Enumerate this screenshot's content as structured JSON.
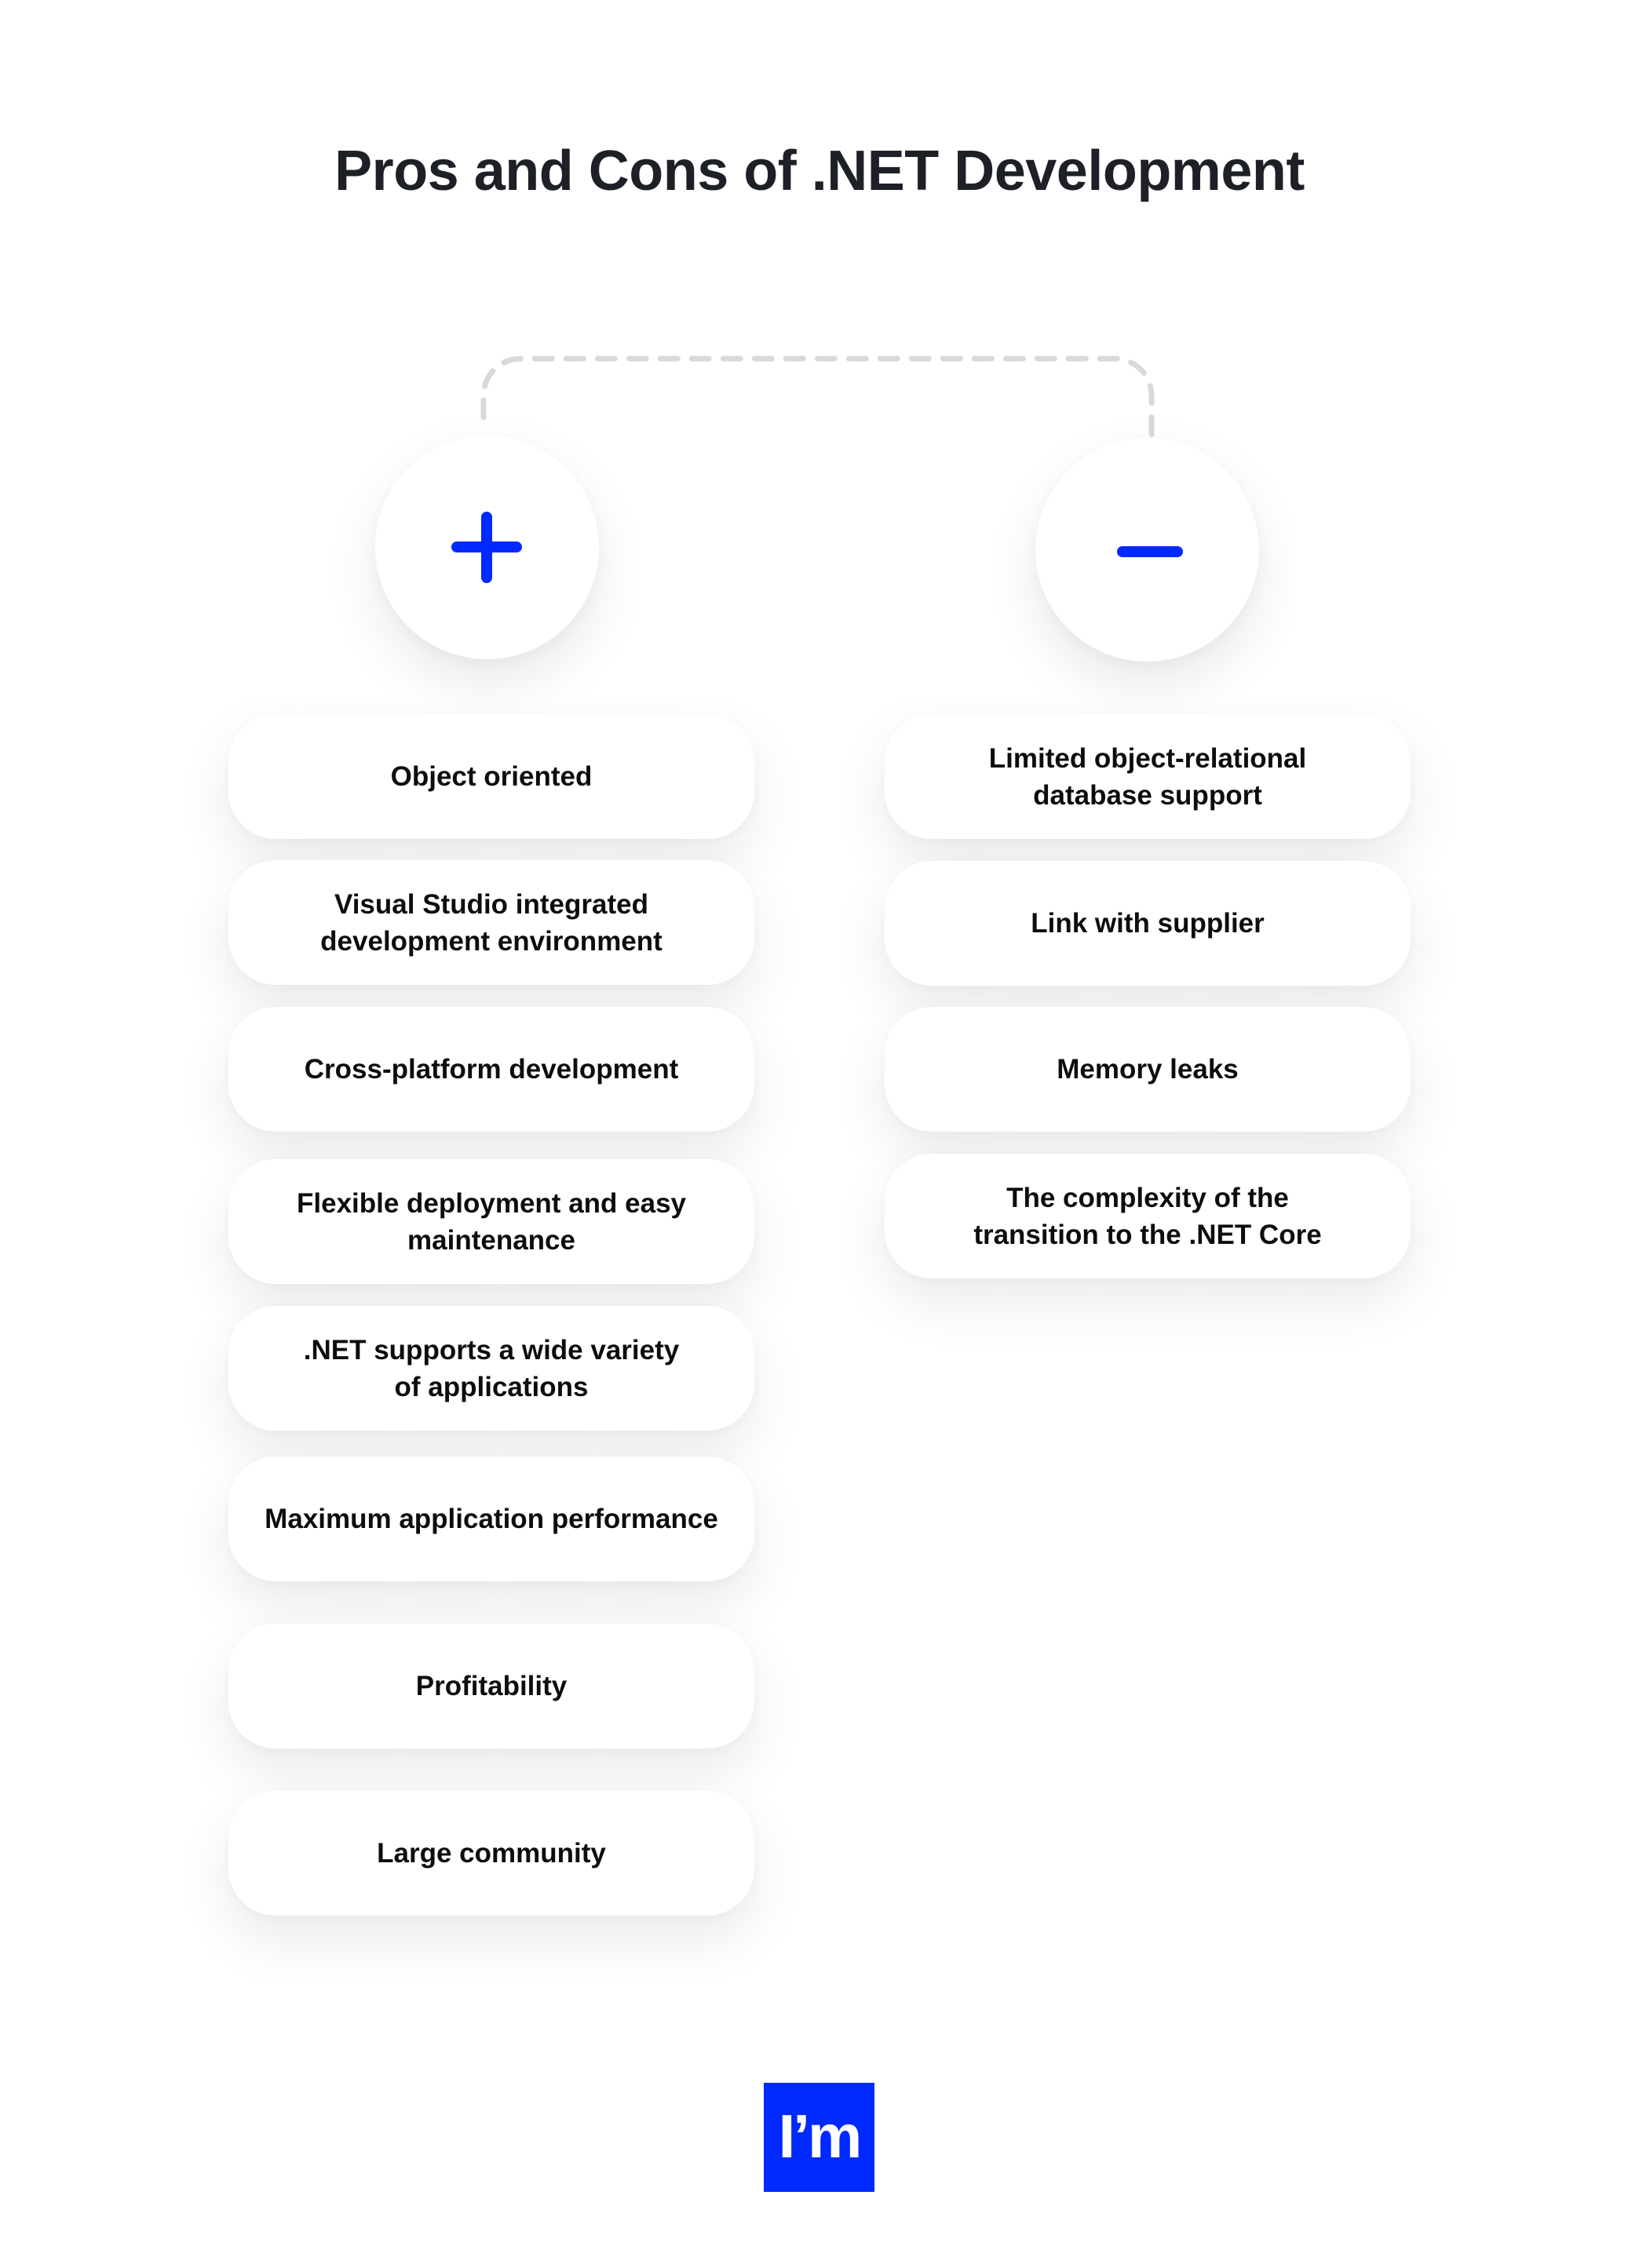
{
  "title": "Pros and Cons of .NET Development",
  "colors": {
    "accent": "#0029ff",
    "title_text": "#1e2027",
    "card_text": "#0d0d0d",
    "connector": "#d9d9d9",
    "background": "#ffffff"
  },
  "pros": {
    "icon": "plus-icon",
    "items": [
      "Object oriented",
      "Visual Studio integrated\ndevelopment environment",
      "Cross-platform development",
      "Flexible deployment and easy\nmaintenance",
      ".NET supports a wide variety\nof applications",
      "Maximum application performance",
      "Profitability",
      "Large community"
    ]
  },
  "cons": {
    "icon": "minus-icon",
    "items": [
      "Limited object-relational\ndatabase support",
      "Link with supplier",
      "Memory leaks",
      "The complexity of the\ntransition to the .NET Core"
    ]
  },
  "logo": {
    "text": "I’m"
  }
}
